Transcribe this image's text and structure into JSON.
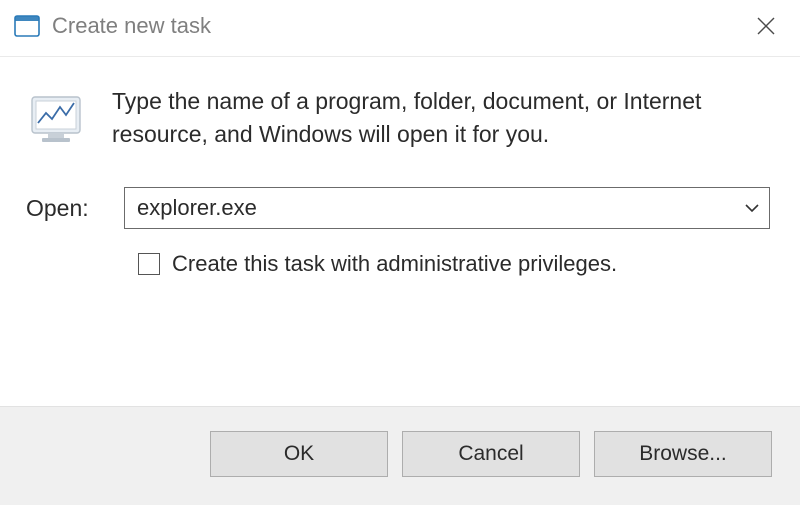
{
  "titlebar": {
    "title": "Create new task"
  },
  "content": {
    "instruction": "Type the name of a program, folder, document, or Internet resource, and Windows will open it for you.",
    "open_label": "Open:",
    "open_value": "explorer.exe",
    "admin_label": "Create this task with administrative privileges.",
    "admin_checked": false
  },
  "buttons": {
    "ok": "OK",
    "cancel": "Cancel",
    "browse": "Browse..."
  }
}
